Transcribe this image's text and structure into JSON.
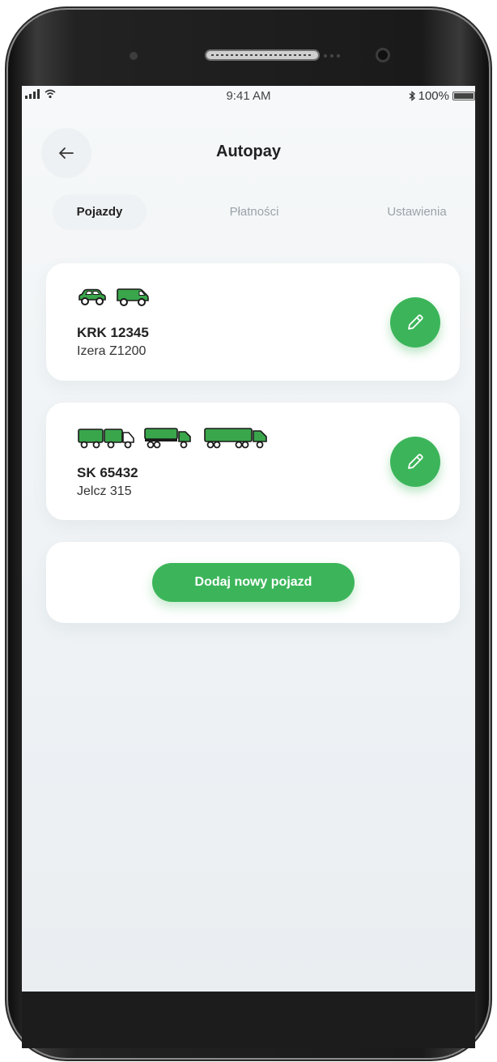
{
  "status_bar": {
    "time": "9:41 AM",
    "battery_text": "100%"
  },
  "header": {
    "title": "Autopay",
    "back_icon": "arrow-left-icon"
  },
  "tabs": [
    {
      "label": "Pojazdy",
      "active": true
    },
    {
      "label": "Płatności",
      "active": false
    },
    {
      "label": "Ustawienia",
      "active": false
    }
  ],
  "vehicles": [
    {
      "plate": "KRK 12345",
      "model": "Izera Z1200",
      "icons": [
        "car-icon",
        "van-icon"
      ]
    },
    {
      "plate": "SK 65432",
      "model": "Jelcz 315",
      "icons": [
        "truck-icon",
        "truck-trailer-icon",
        "road-train-icon"
      ]
    }
  ],
  "add_vehicle_label": "Dodaj nowy pojazd",
  "colors": {
    "accent": "#3cb55a",
    "icon_green": "#3aa64b"
  }
}
